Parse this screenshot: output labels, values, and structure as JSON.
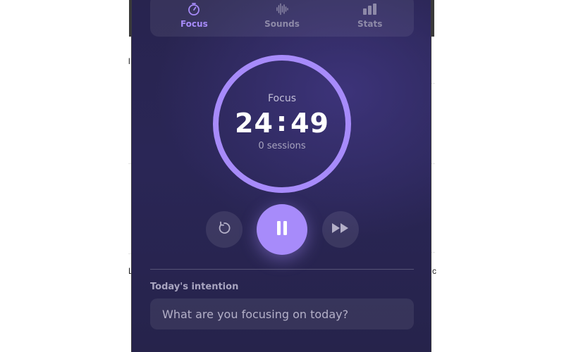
{
  "background_app": {
    "left_glyphs": [
      "l",
      "L"
    ],
    "right_glyph": "c"
  },
  "tabs": [
    {
      "label": "Focus",
      "icon": "timer-icon",
      "active": true
    },
    {
      "label": "Sounds",
      "icon": "sound-wave-icon",
      "active": false
    },
    {
      "label": "Stats",
      "icon": "bar-chart-icon",
      "active": false
    }
  ],
  "timer": {
    "mode": "Focus",
    "minutes": "24",
    "separator": ":",
    "seconds": "49",
    "sessions": "0 sessions",
    "ring_color": "#a78bfa"
  },
  "controls": {
    "reset_icon": "reset-icon",
    "pause_icon": "pause-icon",
    "skip_icon": "skip-forward-icon"
  },
  "intention": {
    "label": "Today's intention",
    "placeholder": "What are you focusing on today?",
    "value": ""
  },
  "colors": {
    "accent": "#a78bfa",
    "panel_bg": "#2a2656"
  }
}
